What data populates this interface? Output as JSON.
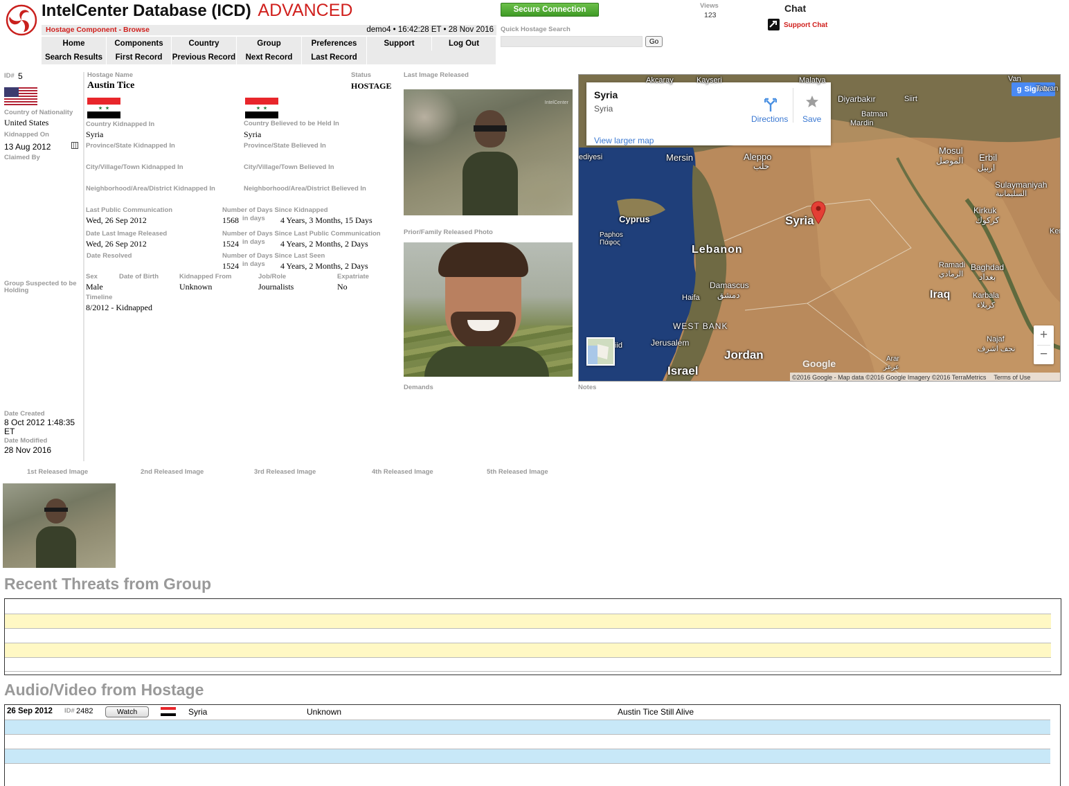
{
  "header": {
    "app_title": "IntelCenter Database (ICD)",
    "edition": "ADVANCED",
    "component": "Hostage Component - Browse",
    "session": "demo4 • 16:42:28 ET • 28 Nov 2016",
    "secure_label": "Secure Connection",
    "quick_search_label": "Quick Hostage Search",
    "go_label": "Go",
    "views_label": "Views",
    "views_count": "123",
    "chat_label": "Chat",
    "support_chat_label": "Support Chat"
  },
  "nav_row1": [
    "Home",
    "Components",
    "Country",
    "Group",
    "Preferences",
    "Support",
    "Log Out"
  ],
  "nav_row2": [
    "Search Results",
    "First Record",
    "Previous Record",
    "Next Record",
    "Last Record",
    ""
  ],
  "left": {
    "id_label": "ID#",
    "id_value": "5",
    "nationality_label": "Country of Nationality",
    "nationality_value": "United States",
    "kidnapped_on_label": "Kidnapped On",
    "kidnapped_on_value": "13 Aug 2012",
    "claimed_by_label": "Claimed By",
    "group_label": "Group Suspected to be Holding",
    "date_created_label": "Date Created",
    "date_created_value": "8 Oct 2012 1:48:35 ET",
    "date_modified_label": "Date Modified",
    "date_modified_value": "28 Nov 2016"
  },
  "hostage": {
    "name_label": "Hostage Name",
    "name_value": "Austin Tice",
    "status_label": "Status",
    "status_value": "HOSTAGE",
    "country_kidnapped_label": "Country Kidnapped In",
    "country_kidnapped_value": "Syria",
    "country_held_label": "Country Believed to be Held In",
    "country_held_value": "Syria",
    "province_kidnapped_label": "Province/State Kidnapped In",
    "province_held_label": "Province/State Believed In",
    "city_kidnapped_label": "City/Village/Town Kidnapped In",
    "city_held_label": "City/Village/Town Believed In",
    "hood_kidnapped_label": "Neighborhood/Area/District Kidnapped In",
    "hood_held_label": "Neighborhood/Area/District Believed In",
    "last_comm_label": "Last Public Communication",
    "last_comm_value": "Wed, 26 Sep 2012",
    "days_kidnapped_label": "Number of Days Since Kidnapped",
    "days_kidnapped_value": "1568",
    "days_kidnapped_span": "4 Years, 3 Months, 15 Days",
    "last_image_date_label": "Date Last Image Released",
    "last_image_date_value": "Wed, 26 Sep 2012",
    "days_comm_label": "Number of Days Since Last Public Communication",
    "days_comm_value": "1524",
    "days_comm_span": "4 Years, 2 Months, 2 Days",
    "resolved_label": "Date Resolved",
    "days_seen_label": "Number of Days Since Last Seen",
    "days_seen_value": "1524",
    "days_seen_span": "4 Years, 2 Months, 2 Days",
    "in_days_label": "in days",
    "sex_label": "Sex",
    "sex_value": "Male",
    "dob_label": "Date of Birth",
    "kidnapped_from_label": "Kidnapped From",
    "kidnapped_from_value": "Unknown",
    "job_label": "Job/Role",
    "job_value": "Journalists",
    "expat_label": "Expatriate",
    "expat_value": "No",
    "timeline_label": "Timeline",
    "timeline_value": "8/2012 - Kidnapped"
  },
  "images": {
    "last_image_label": "Last Image Released",
    "family_photo_label": "Prior/Family Released Photo",
    "demands_label": "Demands",
    "notes_label": "Notes",
    "watermark": "IntelCenter",
    "released": [
      "1st Released Image",
      "2nd Released Image",
      "3rd Released Image",
      "4th Released Image",
      "5th Released Image"
    ]
  },
  "map": {
    "card_title": "Syria",
    "card_sub": "Syria",
    "directions": "Directions",
    "save": "Save",
    "larger": "View larger map",
    "signin": "Sign in",
    "attribution": "©2016 Google - Map data ©2016 Google Imagery ©2016 TerraMetrics",
    "terms": "Terms of Use",
    "google": "Google",
    "zoom_in": "+",
    "zoom_out": "−",
    "labels": {
      "aleppo": "Aleppo",
      "aleppo_ar": "حلب",
      "mersin": "Mersin",
      "cyprus": "Cyprus",
      "paphos": "Paphos",
      "paphos_gr": "Πάφος",
      "lebanon": "Lebanon",
      "damascus": "Damascus",
      "damascus_ar": "دمشق",
      "haifa": "Haifa",
      "westbank": "WEST BANK",
      "jerusalem": "Jerusalem",
      "jordan": "Jordan",
      "israel": "Israel",
      "syria": "Syria",
      "iraq": "Iraq",
      "diyarbakir": "Diyarbakır",
      "batman": "Batman",
      "mardin": "Mardin",
      "siirt": "Siirt",
      "mosul": "Mosul",
      "mosul_ar": "الموصل",
      "erbil": "Erbil",
      "erbil_ar": "اربيل",
      "sulay": "Sulaymaniyah",
      "sulay_ar": "السليمانية",
      "kirkuk": "Kirkuk",
      "kirkuk_ar": "كركوك",
      "ramadi": "Ramadi",
      "ramadi_ar": "الرمادي",
      "baghdad": "Baghdad",
      "baghdad_ar": "بغداد",
      "karbala": "Karbala",
      "karbala_ar": "كربلاء",
      "najaf": "Najaf",
      "najaf_ar": "نجف اشرف",
      "arar": "Arar",
      "arar_ar": "عرعر",
      "akcaray": "Akcaray",
      "kayseri": "Kayseri",
      "malatya": "Malatya",
      "van": "Van",
      "tatvan": "Tatvan",
      "ker": "Ker",
      "ediyesi": "ediyesi",
      "iid": "iid"
    }
  },
  "threats": {
    "title": "Recent Threats from Group"
  },
  "av": {
    "title": "Audio/Video from Hostage",
    "row": {
      "date": "26 Sep 2012",
      "id_label": "ID#",
      "id": "2482",
      "watch": "Watch",
      "country": "Syria",
      "group": "Unknown",
      "title": "Austin Tice Still Alive"
    }
  }
}
